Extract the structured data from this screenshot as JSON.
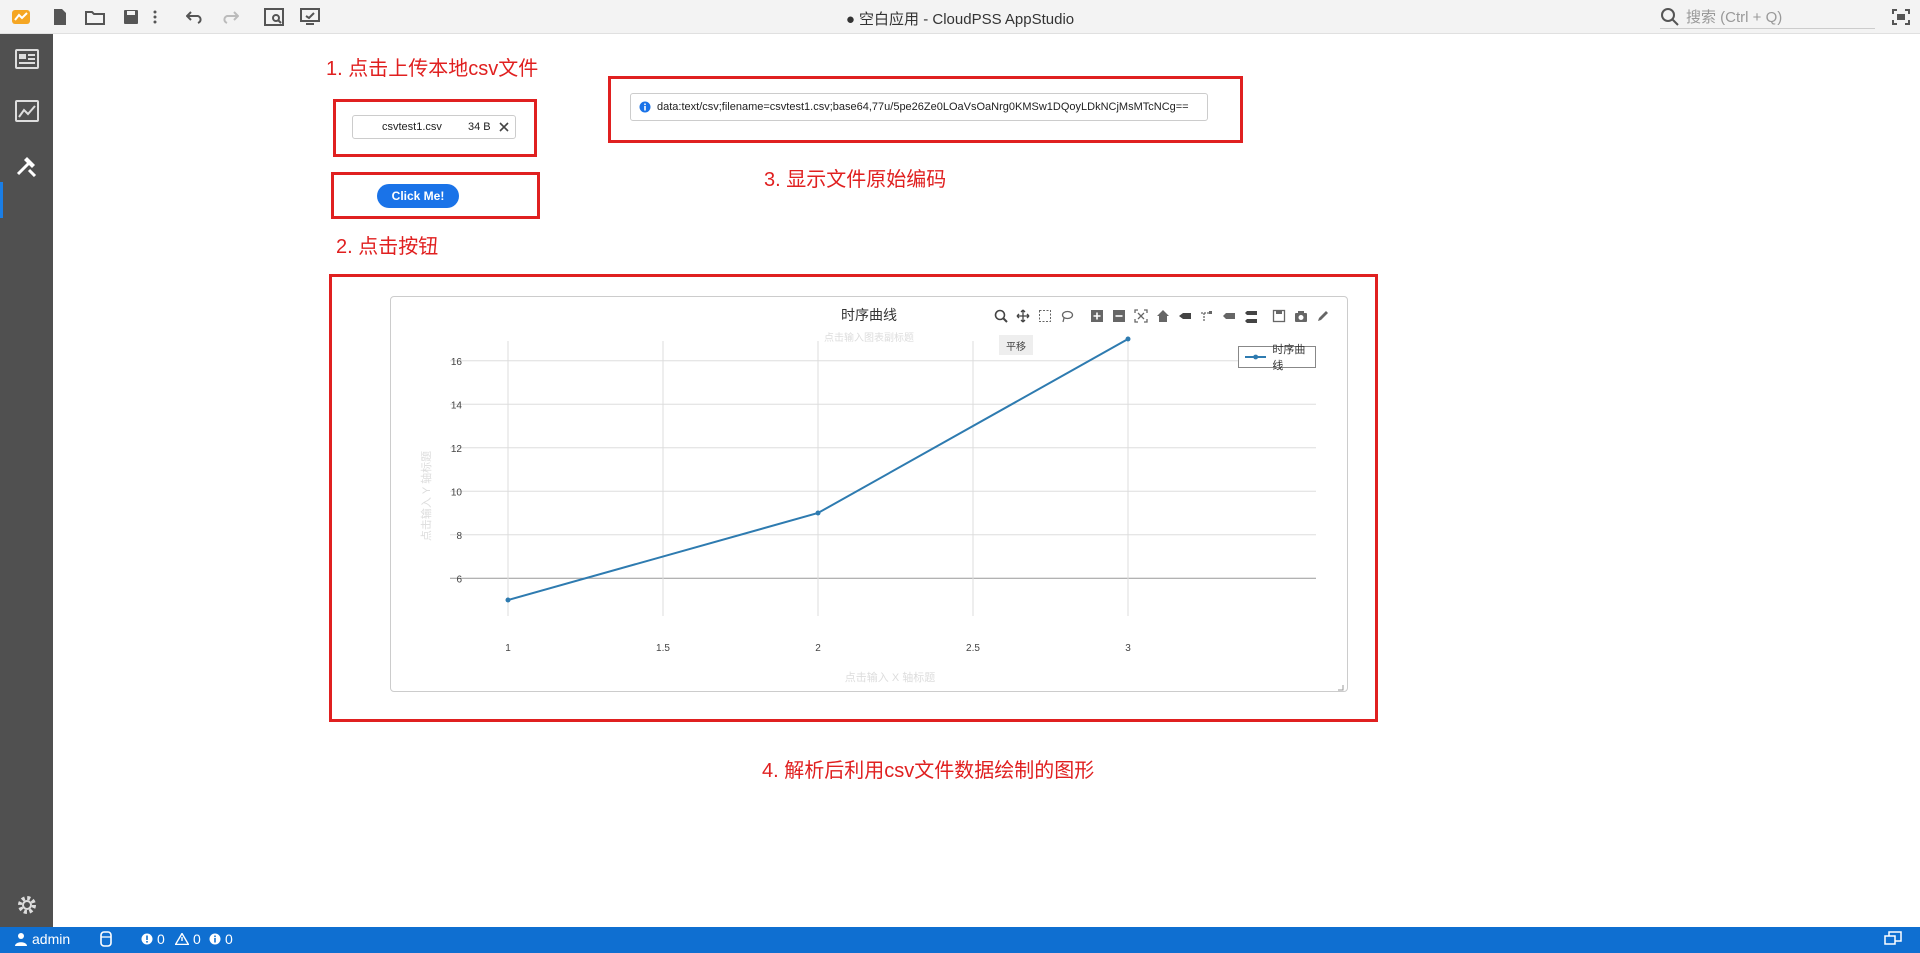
{
  "window": {
    "title": "● 空白应用 - CloudPSS AppStudio"
  },
  "search": {
    "placeholder": "搜索 (Ctrl + Q)"
  },
  "statusbar": {
    "user": "admin",
    "errors": "0",
    "warnings": "0",
    "infos": "0"
  },
  "annotations": {
    "step1": "1. 点击上传本地csv文件",
    "step2": "2. 点击按钮",
    "step3": "3. 显示文件原始编码",
    "step4": "4. 解析后利用csv文件数据绘制的图形"
  },
  "upload": {
    "filename": "csvtest1.csv",
    "size": "34 B"
  },
  "button": {
    "label": "Click Me!"
  },
  "output": {
    "text": "data:text/csv;filename=csvtest1.csv;base64,77u/5pe26Ze0LOaVsOaNrg0KMSw1DQoyLDkNCjMsMTcNCg=="
  },
  "modebar": {
    "tooltip": "平移"
  },
  "chart_data": {
    "type": "line",
    "title": "时序曲线",
    "subtitle_placeholder": "点击输入图表副标题",
    "xlabel": "点击输入 X 轴标题",
    "ylabel": "点击输入 Y 轴标题",
    "x": [
      1,
      2,
      3
    ],
    "series": [
      {
        "name": "时序曲线",
        "values": [
          5,
          9,
          17
        ],
        "color": "#2e7bb0"
      }
    ],
    "xticks": [
      "1",
      "1.5",
      "2",
      "2.5",
      "3"
    ],
    "yticks": [
      "6",
      "8",
      "10",
      "12",
      "14",
      "16"
    ],
    "xlim": [
      1,
      3
    ],
    "ylim": [
      5,
      17
    ],
    "grid": true,
    "legend": "top-right"
  },
  "colors": {
    "annotation": "#e02020",
    "statusbar": "#0f6fd1",
    "sidebar": "#505050",
    "button": "#1a73e8"
  }
}
